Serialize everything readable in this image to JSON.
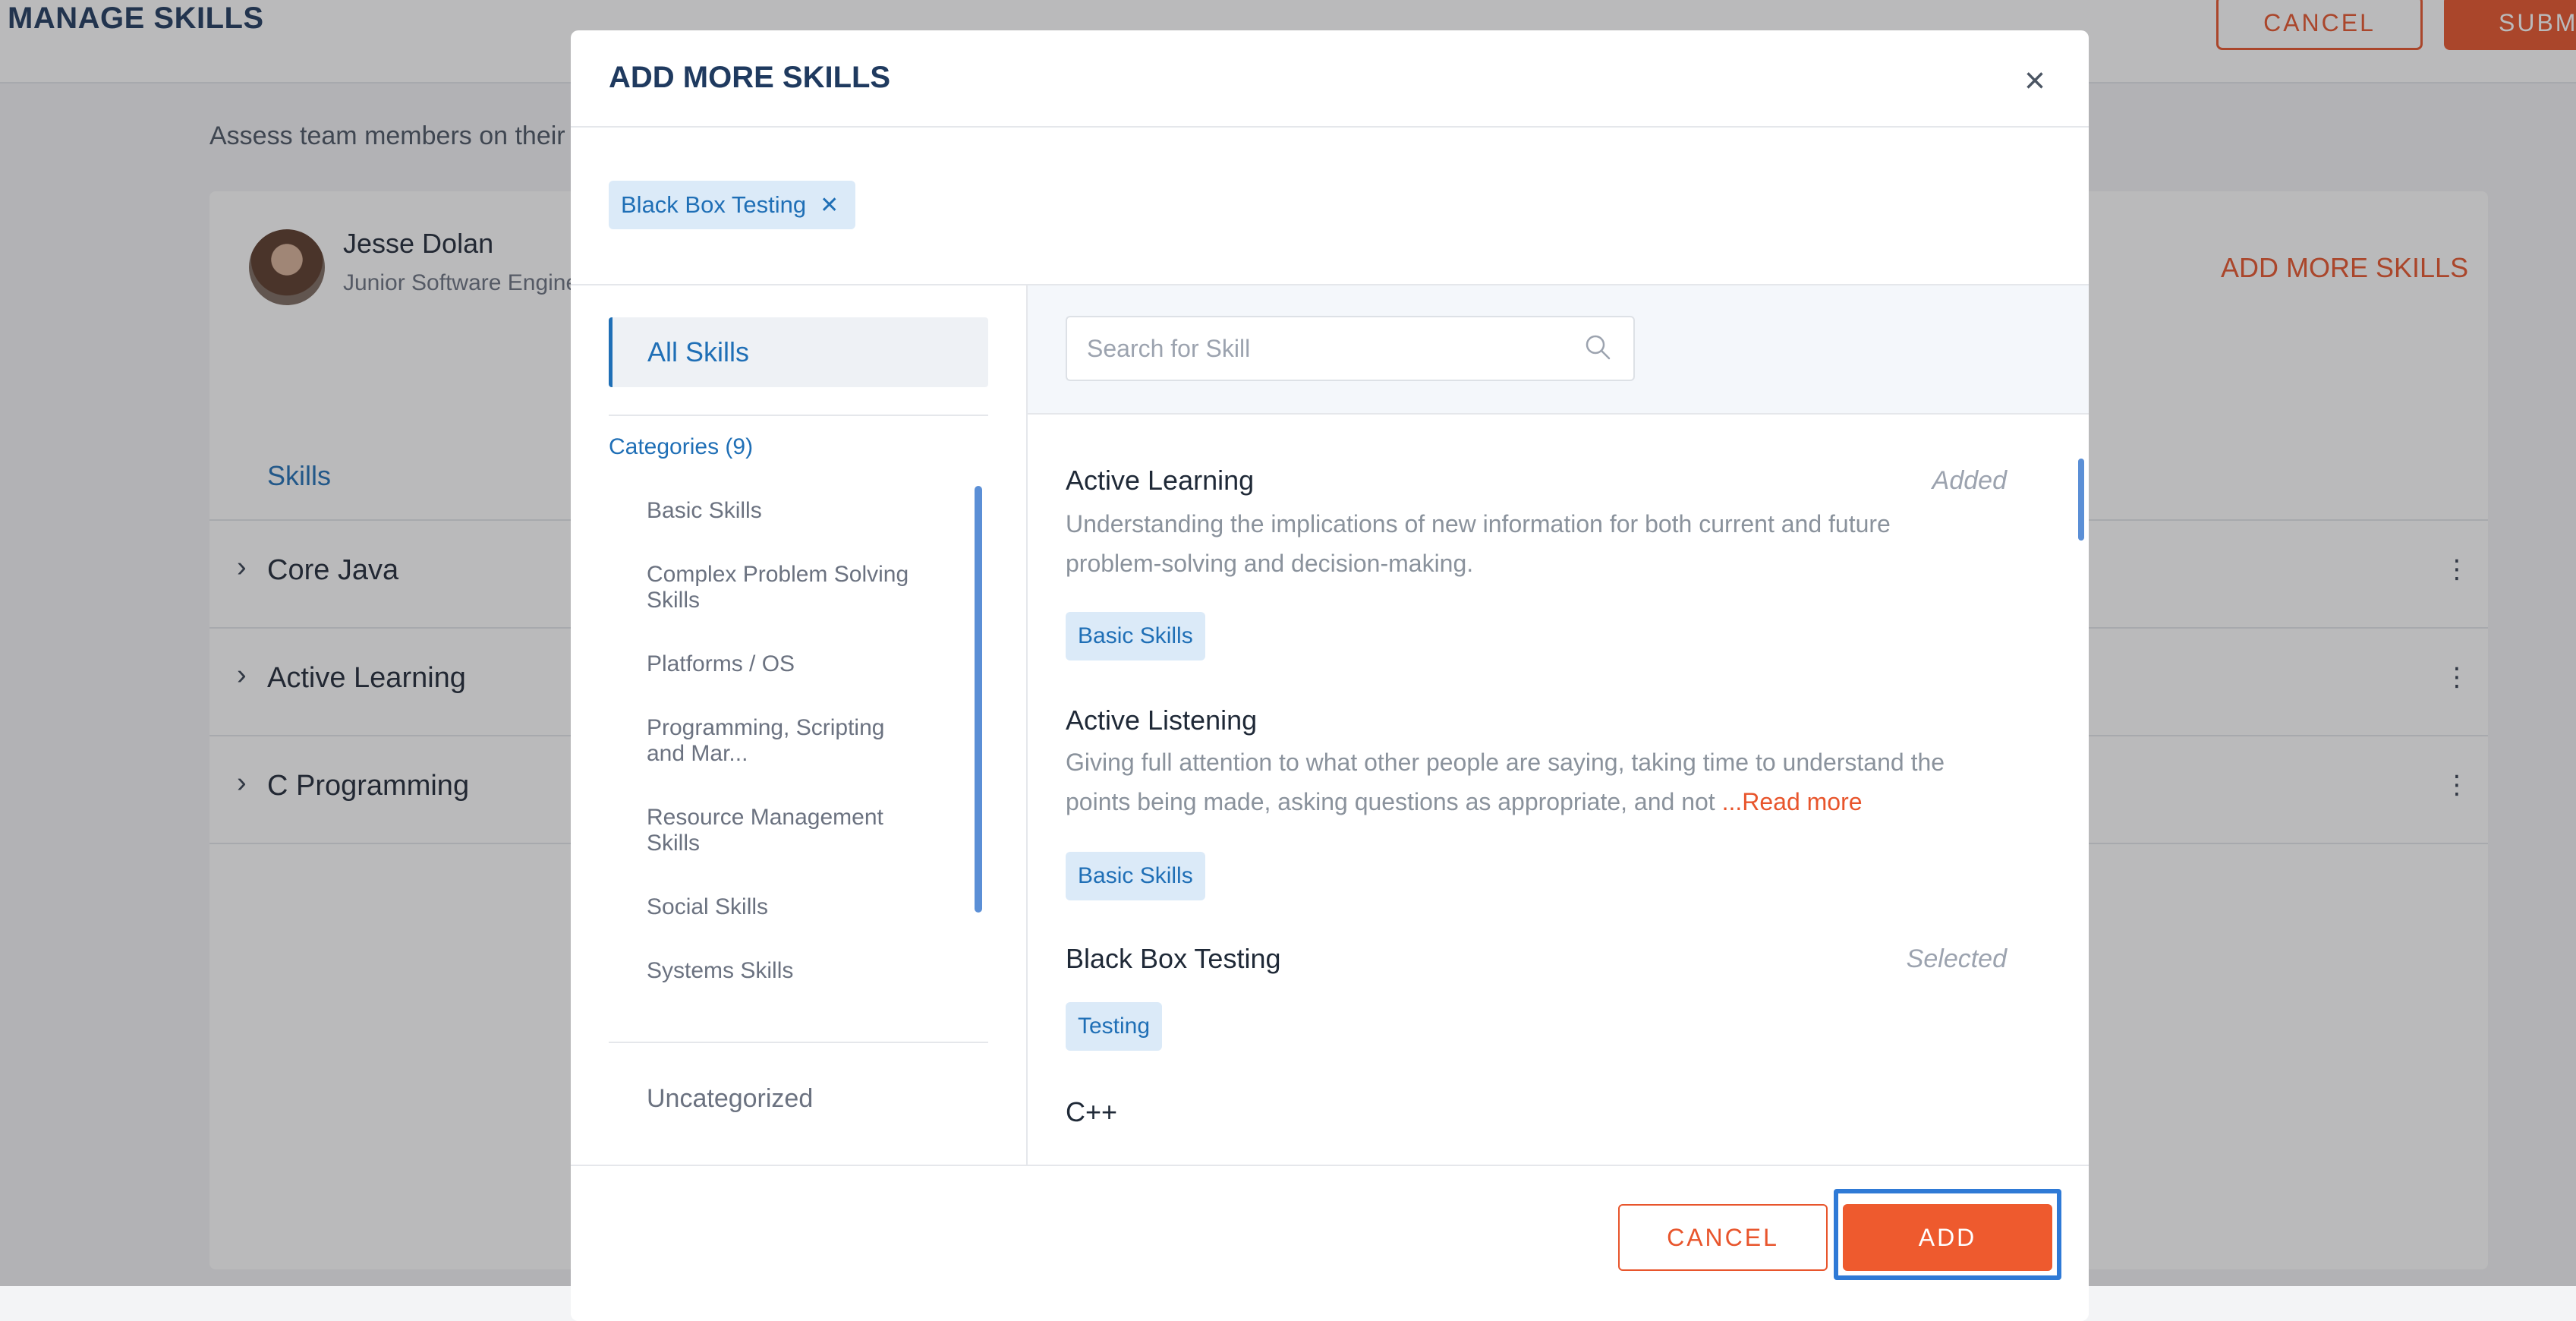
{
  "page": {
    "title": "MANAGE SKILLS",
    "cancel_label": "CANCEL",
    "submit_label": "SUBMI",
    "assess_text": "Assess team members on their p",
    "person": {
      "name": "Jesse Dolan",
      "role": "Junior Software Engine"
    },
    "add_more_skills_link": "ADD MORE SKILLS",
    "skills_tab": "Skills",
    "rows": [
      {
        "title": "Core Java"
      },
      {
        "title": "Active Learning"
      },
      {
        "title": "C Programming"
      }
    ],
    "colors": {
      "accent": "#e8552c",
      "primary": "#1f6fb6",
      "heading": "#1f3a5f"
    }
  },
  "modal": {
    "title": "ADD MORE SKILLS",
    "selected_chip": "Black Box Testing",
    "sidebar": {
      "all_skills": "All Skills",
      "categories_label": "Categories (9)",
      "categories": [
        "Basic Skills",
        "Complex Problem Solving Skills",
        "Platforms / OS",
        "Programming, Scripting and Mar...",
        "Resource Management Skills",
        "Social Skills",
        "Systems Skills"
      ],
      "uncategorized": "Uncategorized"
    },
    "search": {
      "placeholder": "Search for Skill",
      "value": ""
    },
    "skills": [
      {
        "title": "Active Learning",
        "status": "Added",
        "description": "Understanding the implications of new information for both current and future problem-solving and decision-making.",
        "tag": "Basic Skills"
      },
      {
        "title": "Active Listening",
        "status": "",
        "description": "Giving full attention to what other people are saying, taking time to understand the points being made, asking questions as appropriate, and not ",
        "read_more": "...Read more",
        "tag": "Basic Skills"
      },
      {
        "title": "Black Box Testing",
        "status": "Selected",
        "description": "",
        "tag": "Testing"
      },
      {
        "title": "C++",
        "status": "",
        "description": "",
        "tag": ""
      }
    ],
    "footer": {
      "cancel_label": "CANCEL",
      "add_label": "ADD"
    }
  }
}
